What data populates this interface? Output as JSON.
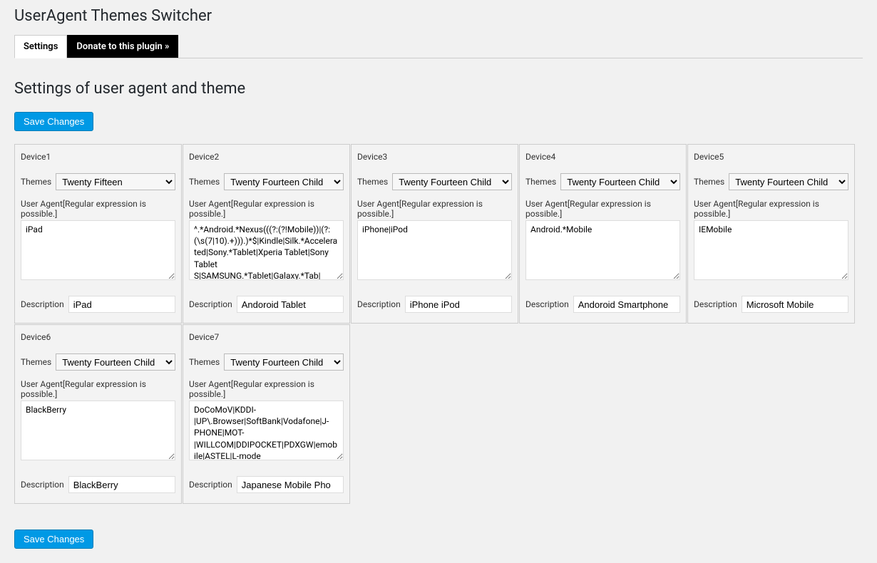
{
  "page_title": "UserAgent Themes Switcher",
  "tabs": {
    "settings": "Settings",
    "donate": "Donate to this plugin »"
  },
  "section_title": "Settings of user agent and theme",
  "save_button": "Save Changes",
  "labels": {
    "themes": "Themes",
    "user_agent": "User Agent[Regular expression is possible.]",
    "description": "Description"
  },
  "theme_options": {
    "twenty_fifteen": "Twenty Fifteen",
    "twenty_fourteen_child": "Twenty Fourteen Child"
  },
  "devices": [
    {
      "title": "Device1",
      "theme": "Twenty Fifteen",
      "ua": "iPad",
      "description": "iPad"
    },
    {
      "title": "Device2",
      "theme": "Twenty Fourteen Child",
      "ua": "^.*Android.*Nexus(((?:(?!Mobile))|(?:(\\s(7|10).+))).)*$|Kindle|Silk.*Accelerated|Sony.*Tablet|Xperia Tablet|Sony Tablet S|SAMSUNG.*Tablet|Galaxy.*Tab|",
      "description": "Andoroid Tablet"
    },
    {
      "title": "Device3",
      "theme": "Twenty Fourteen Child",
      "ua": "iPhone|iPod",
      "description": "iPhone iPod"
    },
    {
      "title": "Device4",
      "theme": "Twenty Fourteen Child",
      "ua": "Android.*Mobile",
      "description": "Andoroid Smartphone"
    },
    {
      "title": "Device5",
      "theme": "Twenty Fourteen Child",
      "ua": "IEMobile",
      "description": "Microsoft Mobile"
    },
    {
      "title": "Device6",
      "theme": "Twenty Fourteen Child",
      "ua": "BlackBerry",
      "description": "BlackBerry"
    },
    {
      "title": "Device7",
      "theme": "Twenty Fourteen Child",
      "ua": "DoCoMoV|KDDI-|UP\\.Browser|SoftBank|Vodafone|J-PHONE|MOT-|WILLCOM|DDIPOCKET|PDXGW|emobile|ASTEL|L-mode",
      "description": "Japanese Mobile Pho"
    }
  ]
}
